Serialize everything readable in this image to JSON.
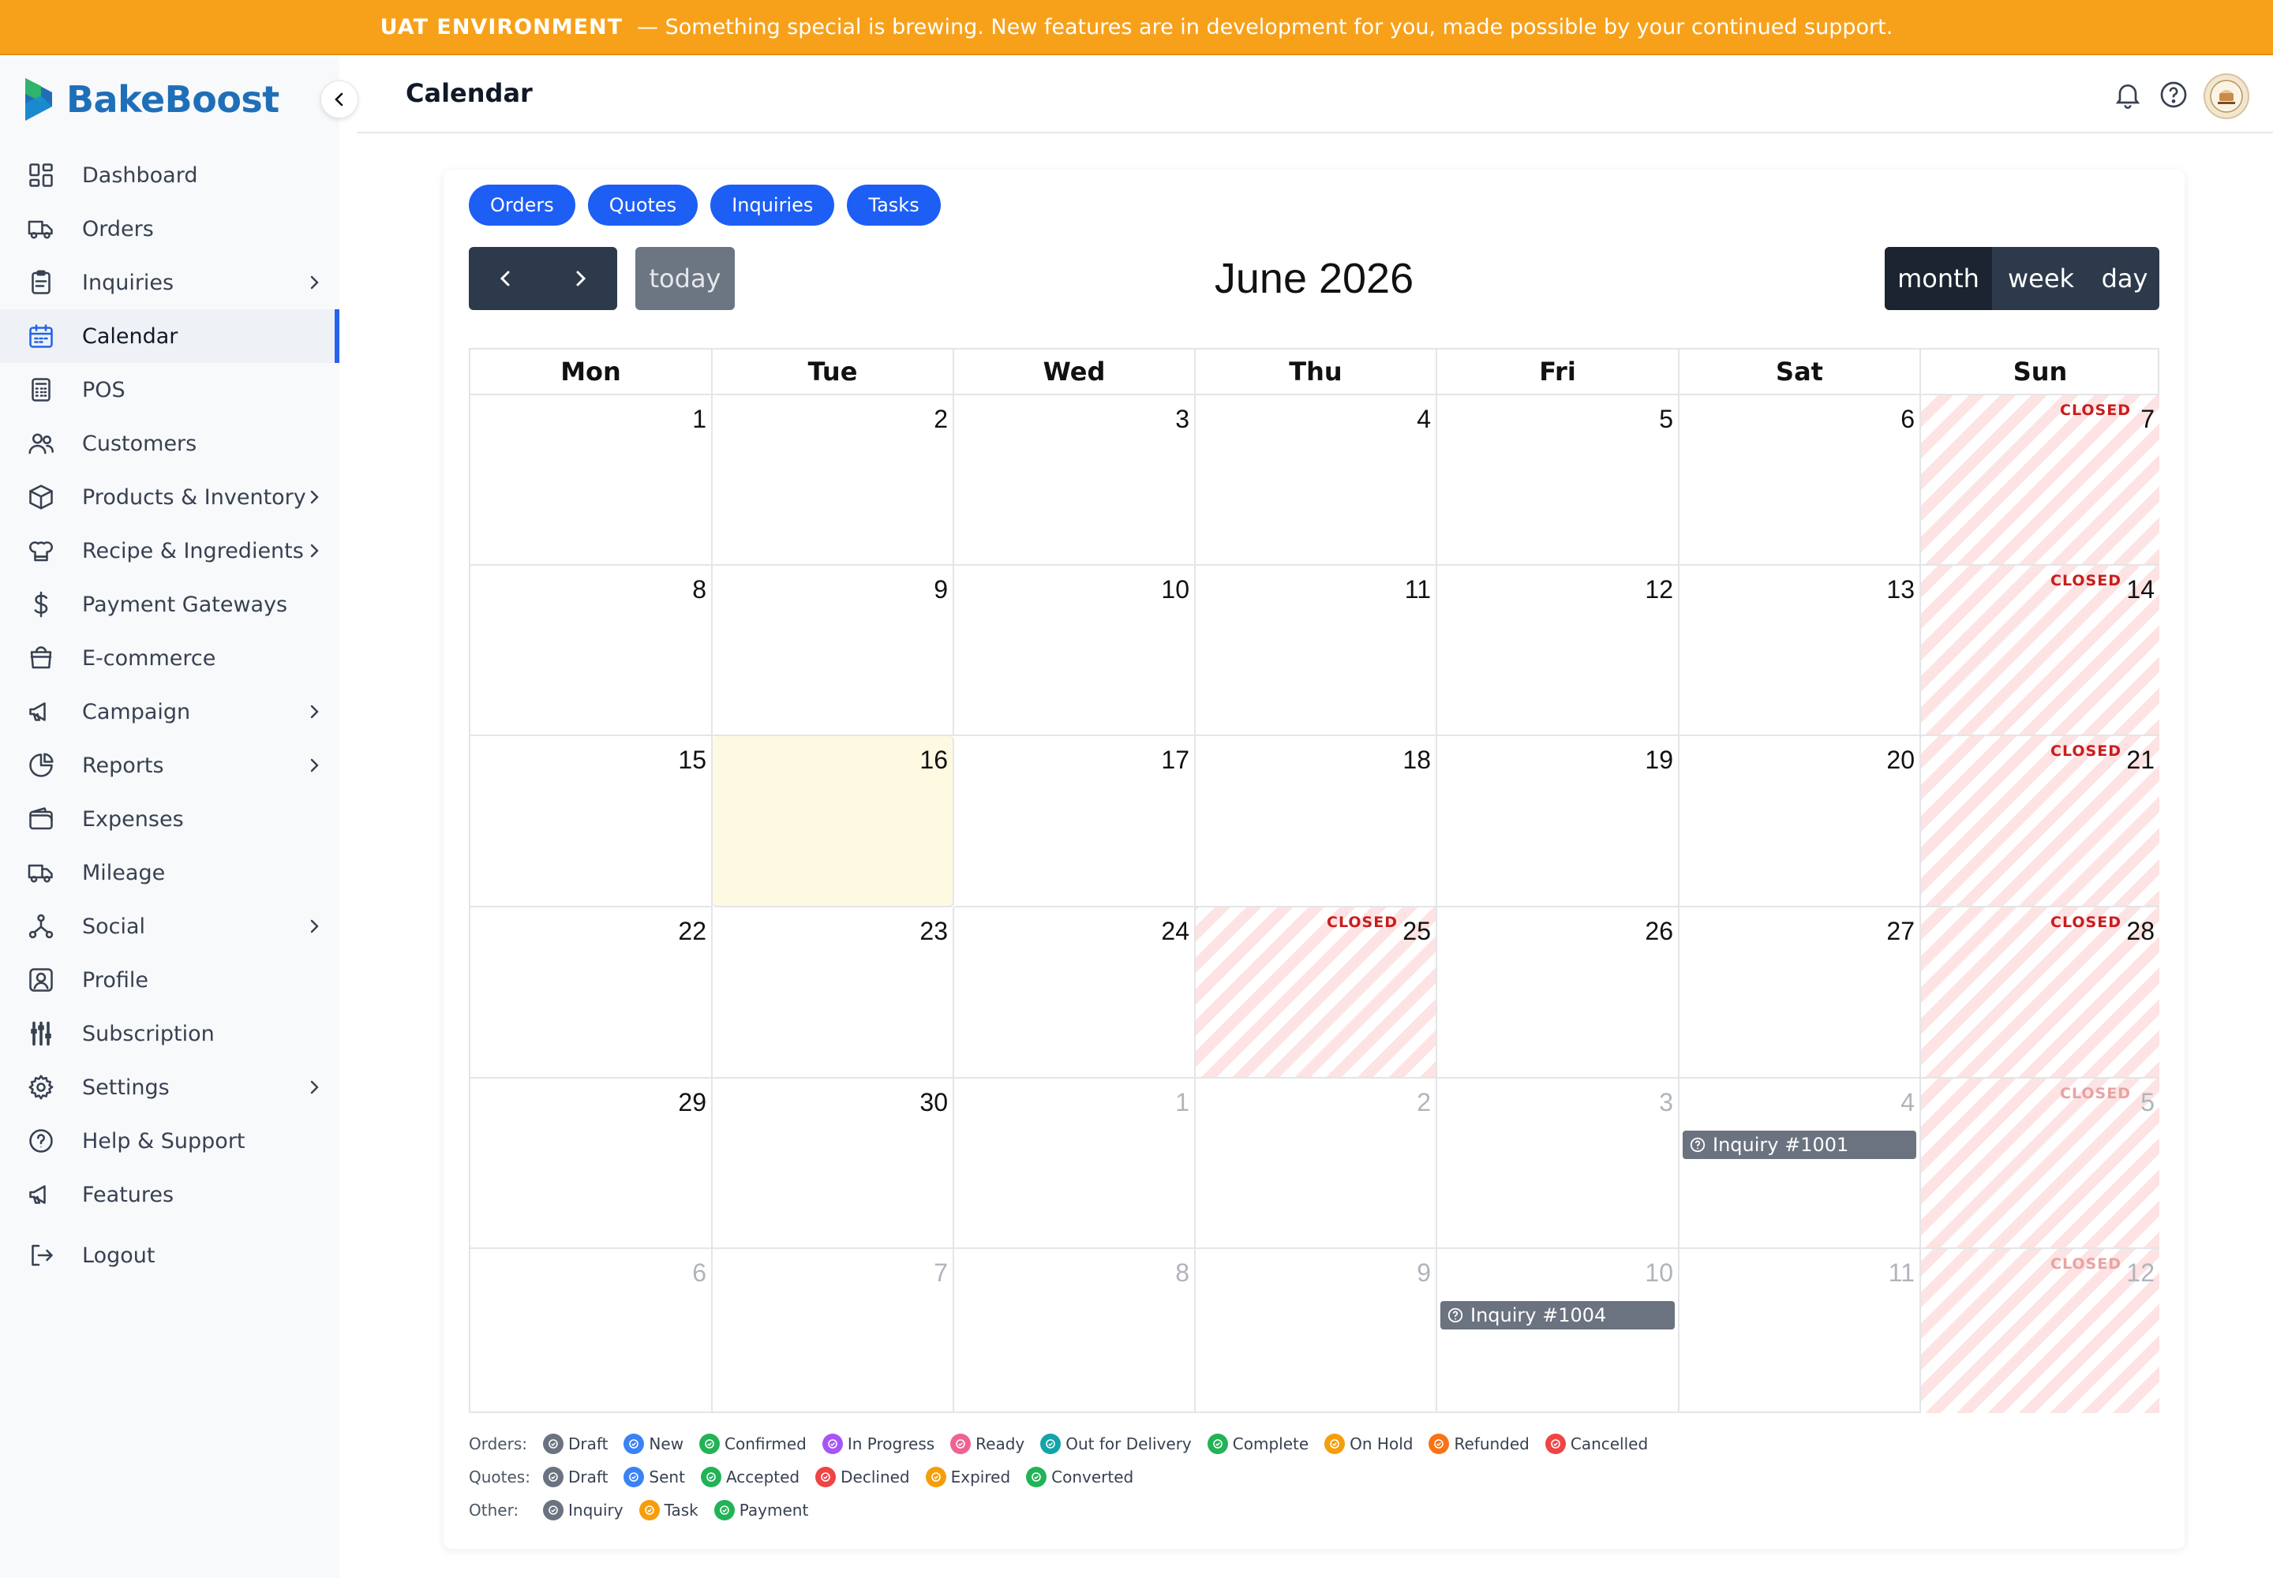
{
  "banner": {
    "title": "UAT ENVIRONMENT",
    "message": "— Something special is brewing. New features are in development for you, made possible by your continued support."
  },
  "app": {
    "name": "BakeBoost"
  },
  "page": {
    "title": "Calendar"
  },
  "sidebar": {
    "items": [
      {
        "label": "Dashboard",
        "icon": "dashboard-icon",
        "chevron": false
      },
      {
        "label": "Orders",
        "icon": "truck-icon",
        "chevron": false
      },
      {
        "label": "Inquiries",
        "icon": "clipboard-icon",
        "chevron": true
      },
      {
        "label": "Calendar",
        "icon": "calendar-icon",
        "chevron": false,
        "active": true
      },
      {
        "label": "POS",
        "icon": "calculator-icon",
        "chevron": false
      },
      {
        "label": "Customers",
        "icon": "users-icon",
        "chevron": false
      },
      {
        "label": "Products & Inventory",
        "icon": "box-icon",
        "chevron": true
      },
      {
        "label": "Recipe & Ingredients",
        "icon": "chef-hat-icon",
        "chevron": true
      },
      {
        "label": "Payment Gateways",
        "icon": "dollar-icon",
        "chevron": false
      },
      {
        "label": "E-commerce",
        "icon": "shopping-bag-icon",
        "chevron": false
      },
      {
        "label": "Campaign",
        "icon": "megaphone-icon",
        "chevron": true
      },
      {
        "label": "Reports",
        "icon": "pie-chart-icon",
        "chevron": true
      },
      {
        "label": "Expenses",
        "icon": "wallet-icon",
        "chevron": false
      },
      {
        "label": "Mileage",
        "icon": "truck-icon",
        "chevron": false
      },
      {
        "label": "Social",
        "icon": "share-icon",
        "chevron": true
      },
      {
        "label": "Profile",
        "icon": "profile-icon",
        "chevron": false
      },
      {
        "label": "Subscription",
        "icon": "sliders-icon",
        "chevron": false
      },
      {
        "label": "Settings",
        "icon": "gear-icon",
        "chevron": true
      },
      {
        "label": "Help & Support",
        "icon": "help-icon",
        "chevron": false
      },
      {
        "label": "Features",
        "icon": "megaphone-icon",
        "chevron": false
      }
    ],
    "logout": "Logout"
  },
  "filters": [
    "Orders",
    "Quotes",
    "Inquiries",
    "Tasks"
  ],
  "calendar": {
    "title": "June 2026",
    "today_label": "today",
    "views": [
      "month",
      "week",
      "day"
    ],
    "active_view": "month",
    "weekdays": [
      "Mon",
      "Tue",
      "Wed",
      "Thu",
      "Fri",
      "Sat",
      "Sun"
    ],
    "closed_label": "CLOSED",
    "weeks": [
      [
        {
          "d": "1"
        },
        {
          "d": "2"
        },
        {
          "d": "3"
        },
        {
          "d": "4"
        },
        {
          "d": "5"
        },
        {
          "d": "6"
        },
        {
          "d": "7",
          "closed": true
        }
      ],
      [
        {
          "d": "8"
        },
        {
          "d": "9"
        },
        {
          "d": "10"
        },
        {
          "d": "11"
        },
        {
          "d": "12"
        },
        {
          "d": "13"
        },
        {
          "d": "14",
          "closed": true
        }
      ],
      [
        {
          "d": "15"
        },
        {
          "d": "16",
          "today": true
        },
        {
          "d": "17"
        },
        {
          "d": "18"
        },
        {
          "d": "19"
        },
        {
          "d": "20"
        },
        {
          "d": "21",
          "closed": true
        }
      ],
      [
        {
          "d": "22"
        },
        {
          "d": "23"
        },
        {
          "d": "24"
        },
        {
          "d": "25",
          "closed": true
        },
        {
          "d": "26"
        },
        {
          "d": "27"
        },
        {
          "d": "28",
          "closed": true
        }
      ],
      [
        {
          "d": "29"
        },
        {
          "d": "30"
        },
        {
          "d": "1",
          "other": true
        },
        {
          "d": "2",
          "other": true
        },
        {
          "d": "3",
          "other": true
        },
        {
          "d": "4",
          "other": true,
          "event": "Inquiry #1001"
        },
        {
          "d": "5",
          "other": true,
          "closed": true
        }
      ],
      [
        {
          "d": "6",
          "other": true
        },
        {
          "d": "7",
          "other": true
        },
        {
          "d": "8",
          "other": true
        },
        {
          "d": "9",
          "other": true
        },
        {
          "d": "10",
          "other": true,
          "event": "Inquiry #1004"
        },
        {
          "d": "11",
          "other": true
        },
        {
          "d": "12",
          "other": true,
          "closed": true
        }
      ]
    ]
  },
  "legend": [
    {
      "label": "Orders:",
      "items": [
        {
          "name": "Draft",
          "color": "#6b7280"
        },
        {
          "name": "New",
          "color": "#3b82f6"
        },
        {
          "name": "Confirmed",
          "color": "#22b357"
        },
        {
          "name": "In Progress",
          "color": "#a855f7"
        },
        {
          "name": "Ready",
          "color": "#f06292"
        },
        {
          "name": "Out for Delivery",
          "color": "#14a3a8"
        },
        {
          "name": "Complete",
          "color": "#22b357"
        },
        {
          "name": "On Hold",
          "color": "#f59e0b"
        },
        {
          "name": "Refunded",
          "color": "#f97316"
        },
        {
          "name": "Cancelled",
          "color": "#ef4444"
        }
      ]
    },
    {
      "label": "Quotes:",
      "items": [
        {
          "name": "Draft",
          "color": "#6b7280"
        },
        {
          "name": "Sent",
          "color": "#3b82f6"
        },
        {
          "name": "Accepted",
          "color": "#22b357"
        },
        {
          "name": "Declined",
          "color": "#ef4444"
        },
        {
          "name": "Expired",
          "color": "#f59e0b"
        },
        {
          "name": "Converted",
          "color": "#22b357"
        }
      ]
    },
    {
      "label": "Other:",
      "items": [
        {
          "name": "Inquiry",
          "color": "#6b7280"
        },
        {
          "name": "Task",
          "color": "#f59e0b"
        },
        {
          "name": "Payment",
          "color": "#22b357"
        }
      ]
    }
  ]
}
